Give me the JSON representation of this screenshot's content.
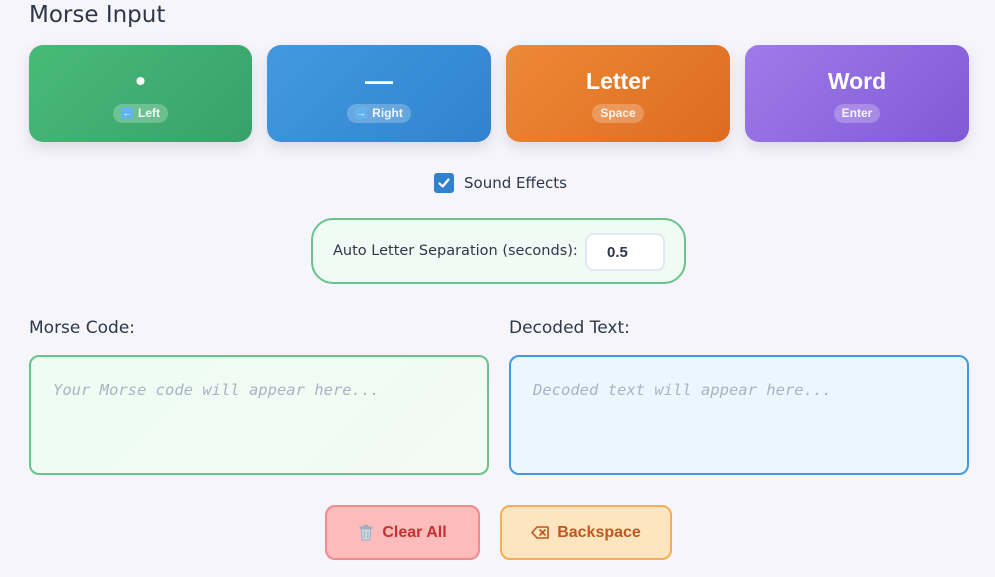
{
  "title": "Morse Input",
  "keys": {
    "dot": {
      "label": "•",
      "hint": "Left"
    },
    "dash": {
      "label": "—",
      "hint": "Right"
    },
    "letter": {
      "label": "Letter",
      "hint": "Space"
    },
    "word": {
      "label": "Word",
      "hint": "Enter"
    }
  },
  "sound": {
    "label": "Sound Effects",
    "checked": true
  },
  "separation": {
    "label": "Auto Letter Separation (seconds):",
    "value": "0.5"
  },
  "morse": {
    "label": "Morse Code:",
    "placeholder": "Your Morse code will appear here...",
    "value": ""
  },
  "decoded": {
    "label": "Decoded Text:",
    "placeholder": "Decoded text will appear here...",
    "value": ""
  },
  "buttons": {
    "clear": "Clear All",
    "backspace": "Backspace"
  },
  "icons": {
    "left_arrow": "left-arrow-key-icon",
    "right_arrow": "right-arrow-key-icon",
    "checkbox": "checkmark-icon",
    "clear": "trash-icon",
    "backspace": "backspace-icon"
  },
  "colors": {
    "dot": "#48bb78",
    "dash": "#4299e1",
    "letter": "#ed8936",
    "word": "#9f7aea",
    "clear_text": "#c53030",
    "backspace_text": "#c05621",
    "checkbox": "#3182ce"
  }
}
